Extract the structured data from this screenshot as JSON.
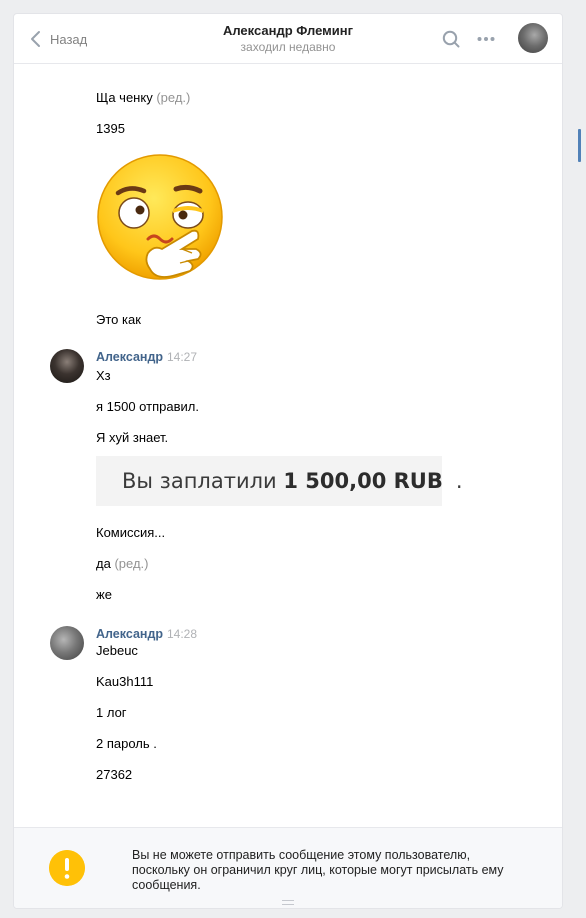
{
  "header": {
    "back_label": "Назад",
    "peer_name": "Александр Флеминг",
    "peer_status": "заходил недавно"
  },
  "messages": {
    "m1": {
      "text": "Ща ченку",
      "edited": "(ред.)"
    },
    "m2": {
      "text": "1395"
    },
    "sticker": {
      "icon": "thinking-face-emoji-icon"
    },
    "m3": {
      "text": "Это как"
    },
    "group1": {
      "author": "Александр",
      "time": "14:27",
      "lines": [
        "Хз",
        "я 1500 отправил.",
        "Я хуй знает."
      ],
      "payment": {
        "prefix": "Вы заплатили",
        "amount": "1 500,00 RUB",
        "suffix": "."
      },
      "after": [
        "Комиссия...",
        "да",
        "же"
      ],
      "edited": "(ред.)"
    },
    "group2": {
      "author": "Александр",
      "time": "14:28",
      "lines": [
        "Jebeuc",
        "Kau3h111",
        "1 лог",
        "2 пароль .",
        "27362"
      ]
    }
  },
  "footer": {
    "warning": "Вы не можете отправить сообщение этому пользователю, поскольку он ограничил круг лиц, которые могут присылать ему сообщения.",
    "icon": "exclamation-icon"
  },
  "colors": {
    "author": "#42648b",
    "warning": "#ffc107",
    "accent": "#5181b8"
  }
}
